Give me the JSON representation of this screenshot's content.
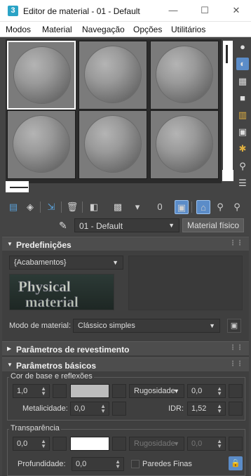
{
  "window": {
    "title": "Editor de material - 01 - Default",
    "app_icon": "3",
    "minimize_glyph": "—",
    "maximize_glyph": "☐",
    "close_glyph": "✕"
  },
  "menu": [
    "Modos",
    "Material",
    "Navegação",
    "Opções",
    "Utilitários"
  ],
  "material": {
    "name": "01 - Default",
    "type_button": "Material físico"
  },
  "presets": {
    "heading": "Predefinições",
    "dropdown_value": "{Acabamentos}",
    "logo_line1": "Physical",
    "logo_line2": "material",
    "mode_label": "Modo de material:",
    "mode_value": "Clássico simples"
  },
  "coating": {
    "heading": "Parâmetros de revestimento"
  },
  "basic": {
    "heading": "Parâmetros básicos",
    "base_group": "Cor de base e reflexões",
    "base_weight": "1,0",
    "roughness_dropdown": "Rugosidade",
    "roughness_value": "0,0",
    "metalness_label": "Metalicidade:",
    "metalness_value": "0,0",
    "ior_label": "IDR:",
    "ior_value": "1,52",
    "transparency_group": "Transparência",
    "transparency_weight": "0,0",
    "trans_roughness_dropdown": "Rugosidade",
    "trans_roughness_value": "0,0",
    "depth_label": "Profundidade:",
    "depth_value": "0,0",
    "thin_walls_label": "Paredes Finas"
  },
  "colors": {
    "base_swatch": "#bdbdbd",
    "transparency_swatch": "#ffffff",
    "accent": "#5b8cc8"
  },
  "icons": {
    "toolbar": [
      "get-material-icon",
      "put-to-scene-icon",
      "assign-to-selection-icon",
      "delete-icon",
      "make-unique-icon",
      "put-to-library-icon",
      "material-id-icon",
      "show-shaded-icon",
      "show-end-result-icon",
      "go-to-parent-icon",
      "go-forward-icon",
      "pick-from-object-icon"
    ],
    "side": [
      "sample-type-icon",
      "backlight-icon",
      "background-icon",
      "sample-uv-icon",
      "video-color-check-icon",
      "make-preview-icon",
      "options-icon",
      "select-by-material-icon",
      "material-navigator-icon"
    ]
  }
}
